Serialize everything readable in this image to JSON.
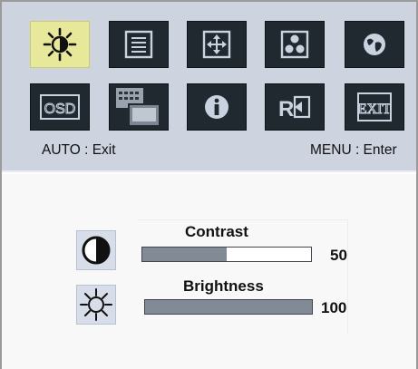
{
  "hints": {
    "auto": "AUTO : Exit",
    "menu": "MENU : Enter"
  },
  "menu_icons": [
    {
      "name": "brightness-contrast-icon",
      "selected": true
    },
    {
      "name": "image-settings-icon",
      "selected": false
    },
    {
      "name": "position-icon",
      "selected": false
    },
    {
      "name": "color-icon",
      "selected": false
    },
    {
      "name": "language-icon",
      "selected": false
    },
    {
      "name": "osd-settings-icon",
      "selected": false
    },
    {
      "name": "input-select-icon",
      "selected": false
    },
    {
      "name": "information-icon",
      "selected": false
    },
    {
      "name": "reset-icon",
      "selected": false
    },
    {
      "name": "exit-icon",
      "selected": false
    }
  ],
  "osd_text": {
    "osd": "OSD",
    "exit": "EXIT"
  },
  "items": [
    {
      "label": "Contrast",
      "value": "50",
      "level": 0.5,
      "icon": "contrast-icon"
    },
    {
      "label": "Brightness",
      "value": "100",
      "level": 1.0,
      "icon": "brightness-icon"
    }
  ],
  "colors": {
    "top_panel": "#cdd3df",
    "icon_tile": "#20292f",
    "selected_tile": "#e7e89a",
    "bar_fill": "#828a95"
  }
}
